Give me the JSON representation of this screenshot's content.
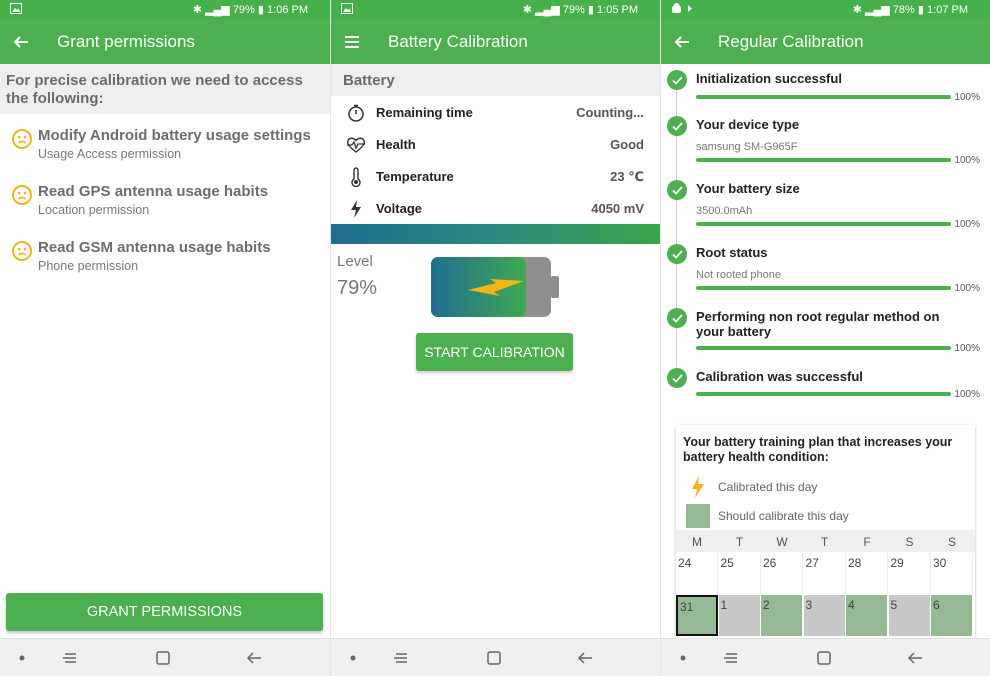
{
  "status": {
    "p1": {
      "battery": "79%",
      "time": "1:06 PM"
    },
    "p2": {
      "battery": "79%",
      "time": "1:05 PM"
    },
    "p3": {
      "battery": "78%",
      "time": "1:07 PM"
    }
  },
  "grant": {
    "title": "Grant permissions",
    "intro": "For precise calibration we need to access the following:",
    "items": [
      {
        "title": "Modify Android battery usage settings",
        "subtitle": "Usage Access permission"
      },
      {
        "title": "Read GPS antenna usage habits",
        "subtitle": "Location permission"
      },
      {
        "title": "Read GSM antenna usage habits",
        "subtitle": "Phone permission"
      }
    ],
    "button": "GRANT PERMISSIONS"
  },
  "calibration": {
    "title": "Battery Calibration",
    "section": "Battery",
    "rows": [
      {
        "label": "Remaining time",
        "value": "Counting...",
        "icon": "timer-icon"
      },
      {
        "label": "Health",
        "value": "Good",
        "icon": "heartbeat-icon"
      },
      {
        "label": "Temperature",
        "value": "23 ℃",
        "icon": "thermometer-icon"
      },
      {
        "label": "Voltage",
        "value": "4050 mV",
        "icon": "lightning-icon"
      }
    ],
    "level_label": "Level",
    "level_value": "79%",
    "level_fraction": 0.79,
    "button": "START CALIBRATION"
  },
  "regular": {
    "title": "Regular Calibration",
    "steps": [
      {
        "title": "Initialization successful",
        "subtitle": "",
        "percent": "100%"
      },
      {
        "title": "Your device type",
        "subtitle": "samsung SM-G965F",
        "percent": "100%"
      },
      {
        "title": "Your battery size",
        "subtitle": "3500.0mAh",
        "percent": "100%"
      },
      {
        "title": "Root status",
        "subtitle": "Not rooted phone",
        "percent": "100%"
      },
      {
        "title": "Performing non root regular method on your battery",
        "subtitle": "",
        "percent": "100%"
      },
      {
        "title": "Calibration was successful",
        "subtitle": "",
        "percent": "100%"
      }
    ],
    "plan": {
      "title": "Your battery training plan that increases your battery health condition:",
      "legend_calibrated": "Calibrated this day",
      "legend_should": "Should calibrate this day",
      "weekdays": [
        "M",
        "T",
        "W",
        "T",
        "F",
        "S",
        "S"
      ],
      "week1": [
        "24",
        "25",
        "26",
        "27",
        "28",
        "29",
        "30"
      ],
      "week2": [
        "31",
        "1",
        "2",
        "3",
        "4",
        "5",
        "6"
      ],
      "week2_status": [
        "green",
        "gray",
        "green",
        "gray",
        "green",
        "gray",
        "green"
      ]
    }
  },
  "colors": {
    "primary": "#4caf50",
    "status_bar": "#46b04a",
    "accent_yellow": "#f0b41e",
    "should_calibrate": "#94b994"
  }
}
